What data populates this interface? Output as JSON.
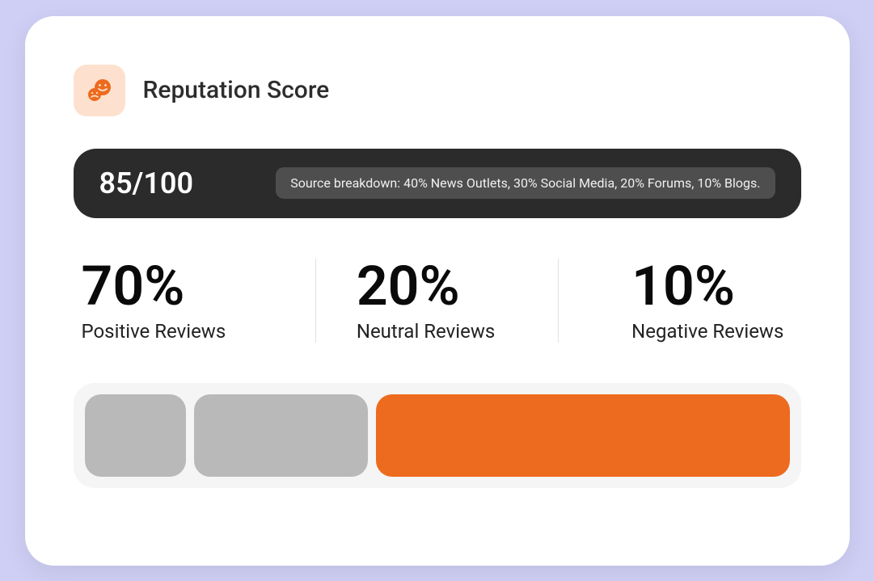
{
  "header": {
    "title": "Reputation Score"
  },
  "score": {
    "display": "85/100",
    "source_breakdown": "Source breakdown: 40% News Outlets, 30% Social Media, 20% Forums, 10% Blogs."
  },
  "stats": {
    "positive": {
      "value": "70%",
      "label": "Positive Reviews"
    },
    "neutral": {
      "value": "20%",
      "label": "Neutral Reviews"
    },
    "negative": {
      "value": "10%",
      "label": "Negative Reviews"
    }
  }
}
